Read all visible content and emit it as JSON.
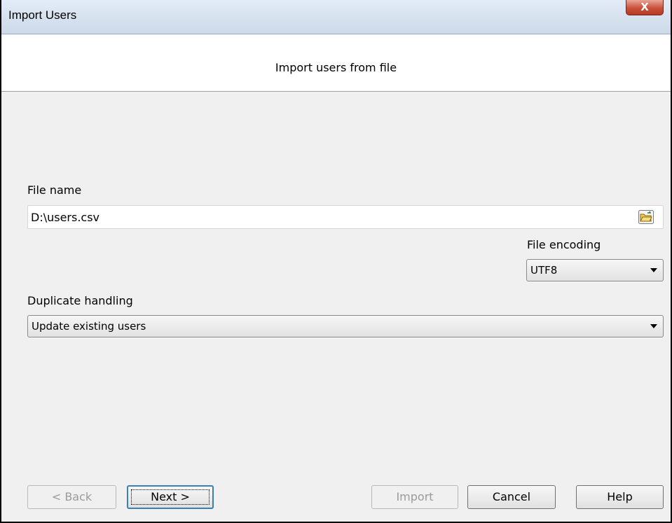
{
  "window": {
    "title": "Import Users",
    "close_label": "X"
  },
  "header": {
    "title": "Import users from file"
  },
  "file": {
    "label": "File name",
    "value": "D:\\users.csv",
    "browse_icon": "folder-open-icon"
  },
  "encoding": {
    "label": "File encoding",
    "selected": "UTF8"
  },
  "duplicate": {
    "label": "Duplicate handling",
    "selected": "Update existing users"
  },
  "buttons": {
    "back": "< Back",
    "next": "Next >",
    "import": "Import",
    "cancel": "Cancel",
    "help": "Help"
  }
}
